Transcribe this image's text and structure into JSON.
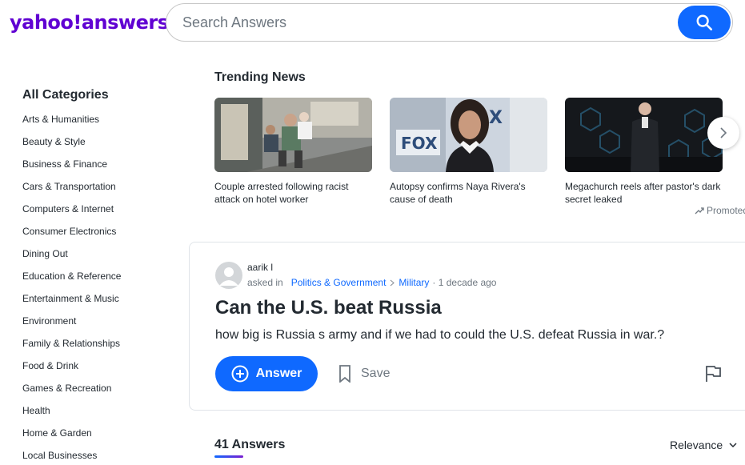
{
  "header": {
    "logo_text": "yahoo!answers",
    "search_placeholder": "Search Answers",
    "brand_color": "#6001d2",
    "search_button_icon": "search-icon"
  },
  "sidebar": {
    "title": "All Categories",
    "items": [
      "Arts & Humanities",
      "Beauty & Style",
      "Business & Finance",
      "Cars & Transportation",
      "Computers & Internet",
      "Consumer Electronics",
      "Dining Out",
      "Education & Reference",
      "Entertainment & Music",
      "Environment",
      "Family & Relationships",
      "Food & Drink",
      "Games & Recreation",
      "Health",
      "Home & Garden",
      "Local Businesses"
    ]
  },
  "trending": {
    "title": "Trending News",
    "cards": [
      {
        "caption": "Couple arrested following racist attack on hotel worker"
      },
      {
        "caption": "Autopsy confirms Naya Rivera's cause of death"
      },
      {
        "caption": "Megachurch reels after pastor's dark secret leaked"
      }
    ],
    "promoted_label": "Promoted"
  },
  "question": {
    "author": "aarik l",
    "asked_in": "asked in",
    "category": "Politics & Government",
    "subcategory": "Military",
    "time": "· 1 decade ago",
    "title": "Can the U.S. beat Russia",
    "body": "how big is Russia s army and if we had to could the U.S. defeat Russia in war.?",
    "answer_label": "Answer",
    "save_label": "Save"
  },
  "answers": {
    "count_label": "41 Answers",
    "sort_label": "Relevance"
  },
  "colors": {
    "accent": "#0f69ff",
    "text": "#232a31",
    "muted": "#6e7780"
  }
}
